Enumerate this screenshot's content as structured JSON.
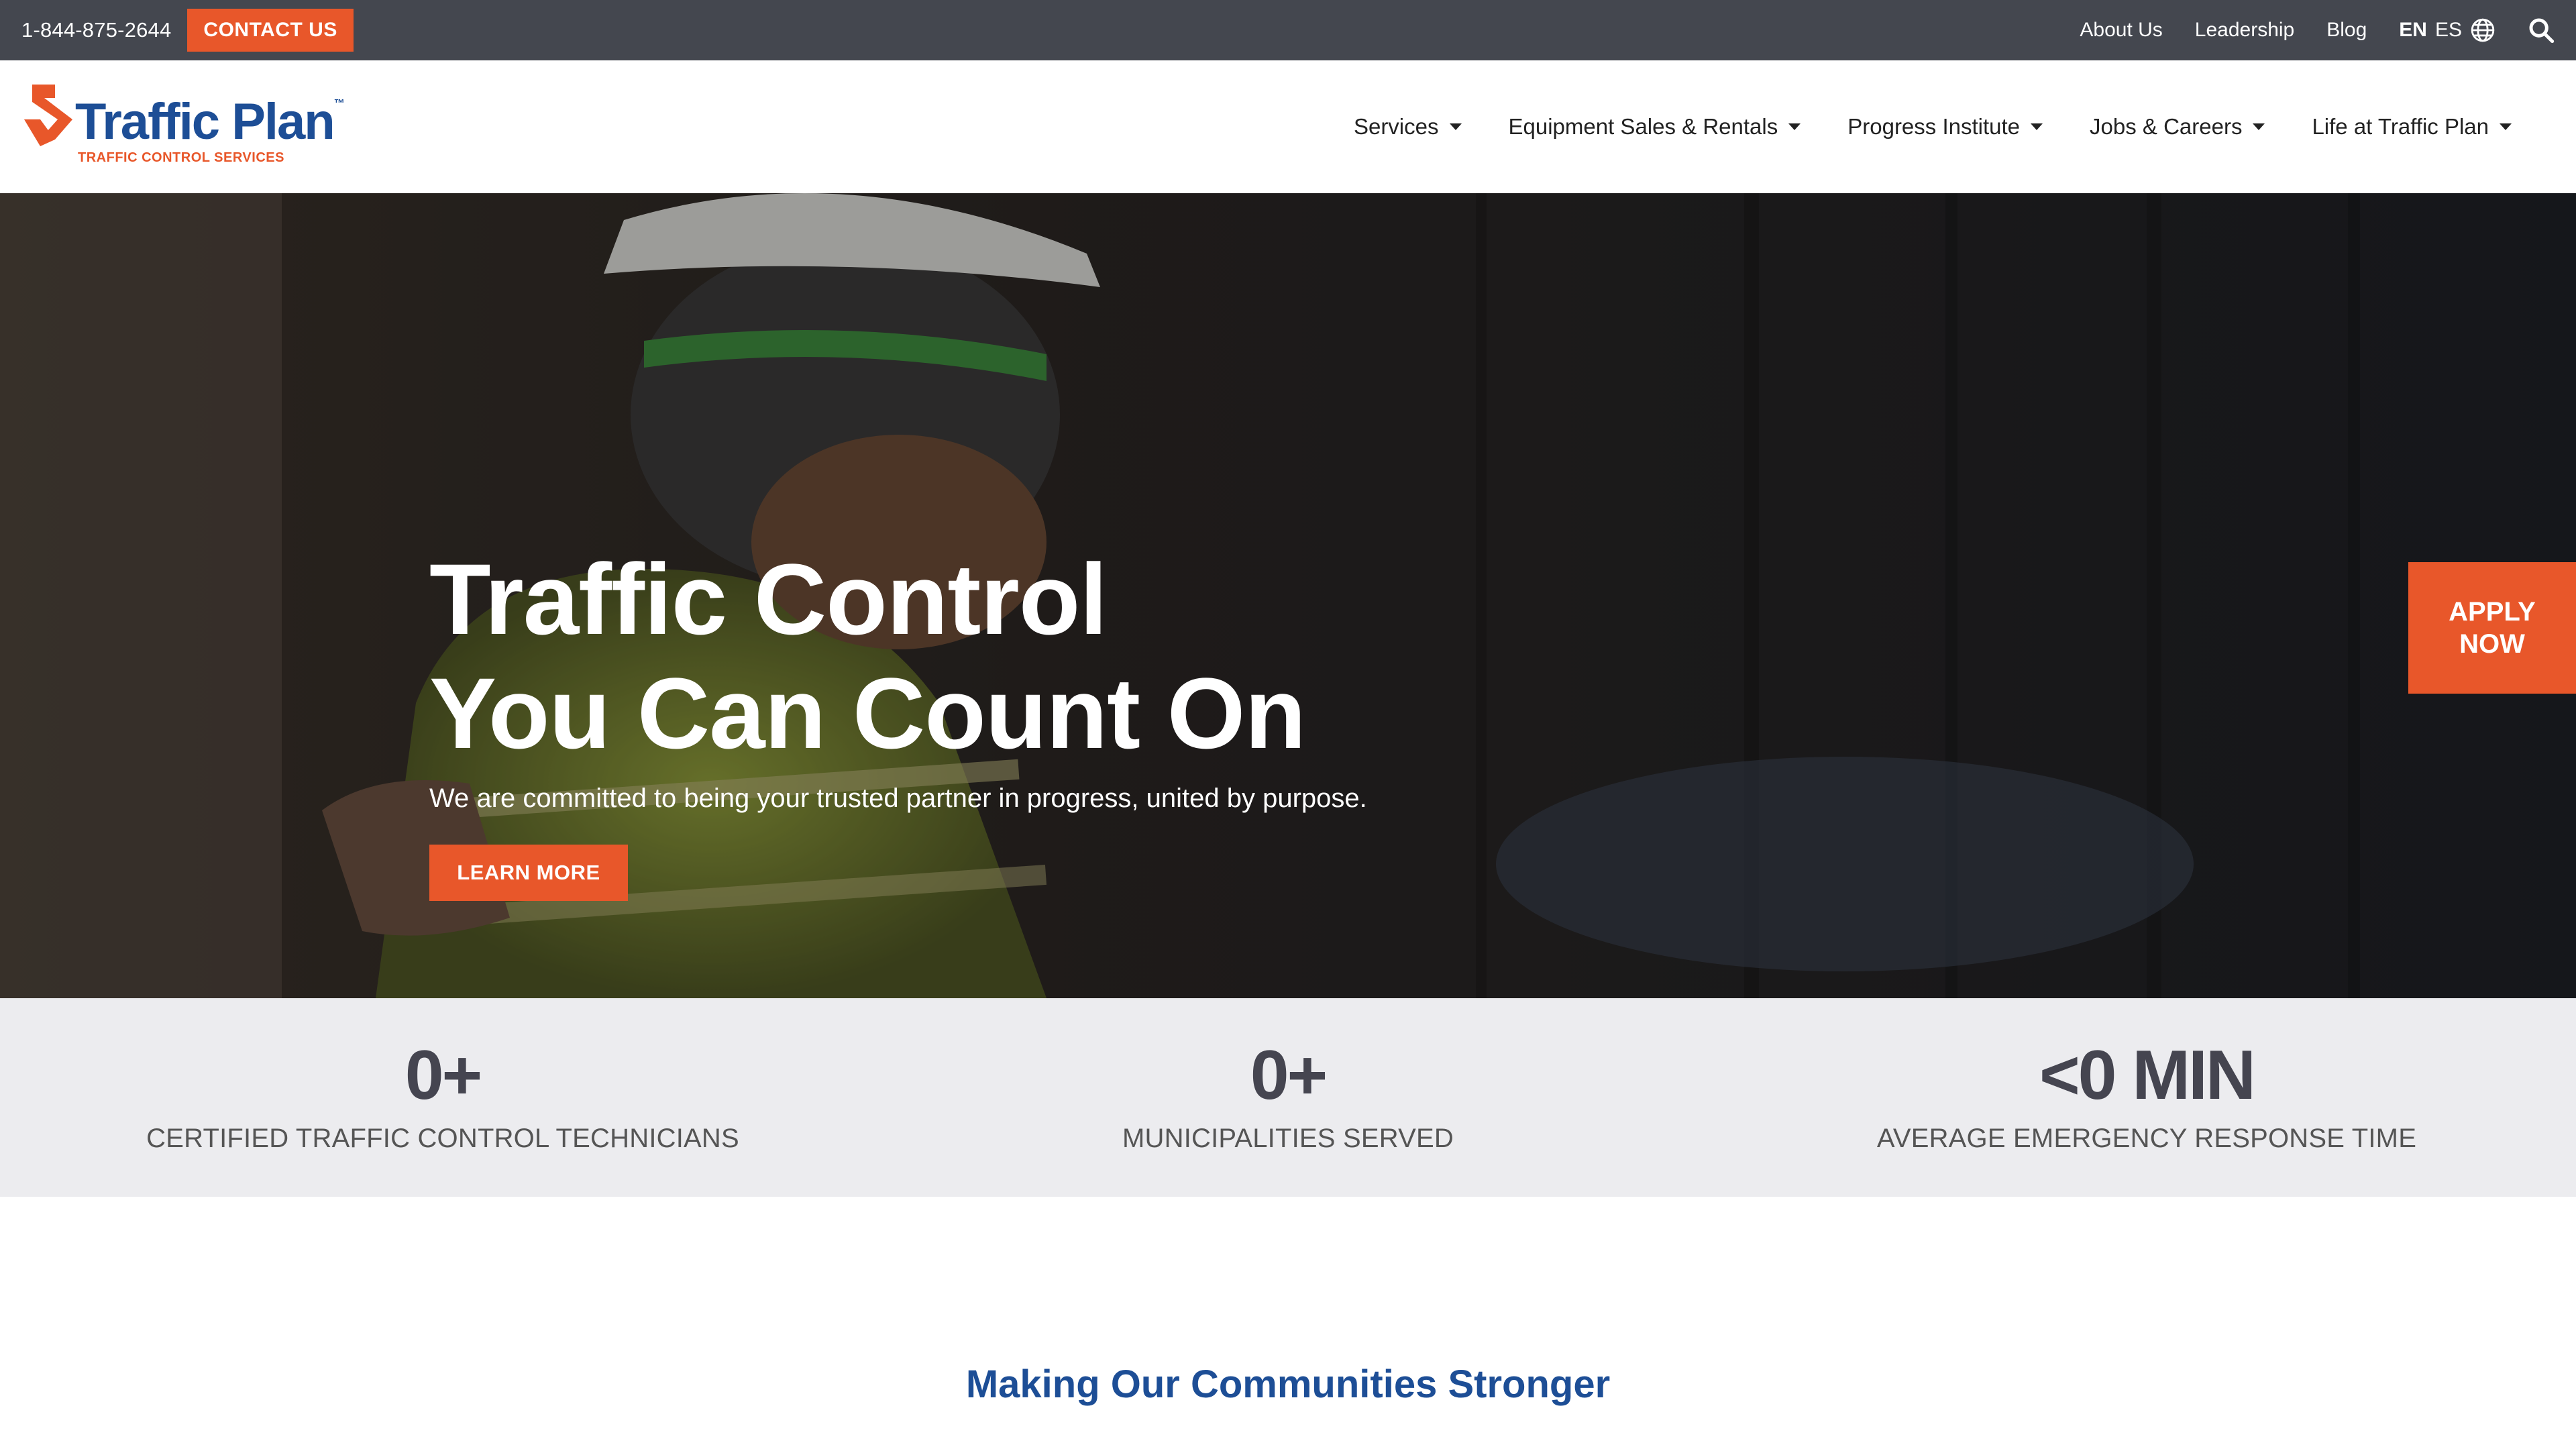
{
  "topbar": {
    "phone": "1-844-875-2644",
    "contact_label": "CONTACT US",
    "links": [
      "About Us",
      "Leadership",
      "Blog"
    ],
    "lang_en": "EN",
    "lang_es": "ES",
    "globe_icon": "globe-icon",
    "search_icon": "search-icon"
  },
  "logo": {
    "name": "Traffic Plan",
    "tm": "™",
    "tagline": "TRAFFIC CONTROL SERVICES"
  },
  "nav": {
    "items": [
      {
        "label": "Services"
      },
      {
        "label": "Equipment Sales & Rentals"
      },
      {
        "label": "Progress Institute"
      },
      {
        "label": "Jobs & Careers"
      },
      {
        "label": "Life at Traffic Plan"
      }
    ]
  },
  "hero": {
    "title_line1": "Traffic Control",
    "title_line2": "You Can Count On",
    "subtitle": "We are committed to being your trusted partner in progress, united by purpose.",
    "cta": "LEARN MORE",
    "apply_line1": "APPLY",
    "apply_line2": "NOW"
  },
  "stats": [
    {
      "value": "0+",
      "label": "CERTIFIED TRAFFIC CONTROL TECHNICIANS"
    },
    {
      "value": "0+",
      "label": "MUNICIPALITIES SERVED"
    },
    {
      "value": "<0 MIN",
      "label": "AVERAGE EMERGENCY RESPONSE TIME"
    }
  ],
  "section": {
    "title": "Making Our Communities Stronger"
  },
  "colors": {
    "accent": "#e8572a",
    "brand_blue": "#1d4e96",
    "topbar": "#44474f",
    "stats_bg": "#ececef"
  }
}
